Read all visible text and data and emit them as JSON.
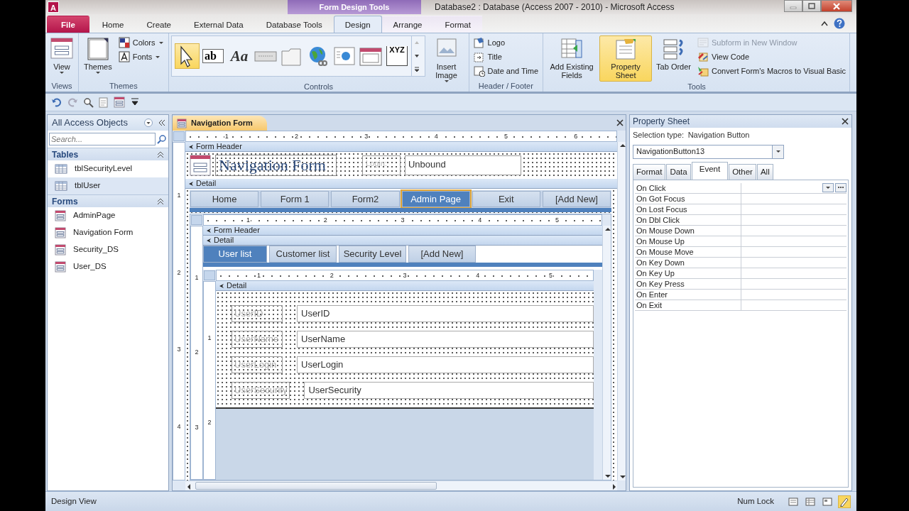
{
  "window": {
    "logo": "A",
    "context_group": "Form Design Tools",
    "title": "Database2 : Database (Access 2007 - 2010)  -  Microsoft Access"
  },
  "ribbon_tabs": [
    {
      "label": "File",
      "kind": "file",
      "selected": false
    },
    {
      "label": "Home",
      "kind": "tab",
      "selected": false
    },
    {
      "label": "Create",
      "kind": "tab",
      "selected": false
    },
    {
      "label": "External Data",
      "kind": "tab",
      "selected": false
    },
    {
      "label": "Database Tools",
      "kind": "tab",
      "selected": false
    },
    {
      "label": "Design",
      "kind": "tab",
      "selected": true
    },
    {
      "label": "Arrange",
      "kind": "tab",
      "selected": false
    },
    {
      "label": "Format",
      "kind": "tab",
      "selected": false
    }
  ],
  "ribbon_groups": [
    {
      "label": "Views",
      "items": [
        {
          "kind": "large",
          "label": "View",
          "dropdown": true
        }
      ]
    },
    {
      "label": "Themes",
      "items": [
        {
          "kind": "large",
          "label": "Themes",
          "dropdown": true
        },
        {
          "kind": "small",
          "label": "Colors",
          "dropdown": true
        },
        {
          "kind": "small",
          "label": "Fonts",
          "dropdown": true
        }
      ]
    },
    {
      "label": "Controls",
      "items": [
        {
          "kind": "tool",
          "selected": true
        },
        {
          "kind": "tool",
          "selected": false,
          "text": "ab"
        },
        {
          "kind": "tool",
          "selected": false,
          "text": "Aa"
        },
        {
          "kind": "tool",
          "selected": false
        },
        {
          "kind": "tool",
          "selected": false
        },
        {
          "kind": "tool",
          "selected": false
        },
        {
          "kind": "tool",
          "selected": false
        },
        {
          "kind": "tool",
          "selected": false
        },
        {
          "kind": "tool",
          "selected": false,
          "text": "XYZ"
        },
        {
          "kind": "large",
          "label": "Insert Image",
          "dropdown": true
        }
      ]
    },
    {
      "label": "Header / Footer",
      "items": [
        {
          "kind": "small",
          "label": "Logo"
        },
        {
          "kind": "small",
          "label": "Title"
        },
        {
          "kind": "small",
          "label": "Date and Time"
        }
      ]
    },
    {
      "label": "Tools",
      "items": [
        {
          "kind": "large",
          "label": "Add Existing Fields",
          "selected": false
        },
        {
          "kind": "large",
          "label": "Property Sheet",
          "selected": true
        },
        {
          "kind": "large",
          "label": "Tab Order",
          "selected": false
        },
        {
          "kind": "small",
          "label": "Subform in New Window",
          "disabled": true
        },
        {
          "kind": "small",
          "label": "View Code",
          "disabled": false
        },
        {
          "kind": "small",
          "label": "Convert Form's Macros to Visual Basic",
          "disabled": false
        }
      ]
    }
  ],
  "nav_pane": {
    "title": "All Access Objects",
    "search": {
      "placeholder": "Search..."
    },
    "groups": [
      {
        "label": "Tables",
        "kind": "table",
        "items": [
          {
            "label": "tblSecurityLevel",
            "selected": false
          },
          {
            "label": "tblUser",
            "selected": true
          }
        ]
      },
      {
        "label": "Forms",
        "kind": "form",
        "items": [
          {
            "label": "AdminPage",
            "selected": false
          },
          {
            "label": "Navigation Form",
            "selected": false
          },
          {
            "label": "Security_DS",
            "selected": false
          },
          {
            "label": "User_DS",
            "selected": false
          }
        ]
      }
    ]
  },
  "document": {
    "tab": "Navigation Form",
    "ruler": [
      "1",
      "2",
      "3",
      "4",
      "5",
      "6"
    ],
    "vruler": [
      "1",
      "2",
      "3",
      "4"
    ],
    "form_header": {
      "section": "Form Header",
      "title": "Navigation Form",
      "login_label": "Login:",
      "login_value": "Unbound"
    },
    "detail": {
      "section": "Detail",
      "nav_buttons": [
        {
          "label": "Home",
          "selected": false
        },
        {
          "label": "Form 1",
          "selected": false
        },
        {
          "label": "Form2",
          "selected": false
        },
        {
          "label": "Admin Page",
          "selected": true
        },
        {
          "label": "Exit",
          "selected": false
        },
        {
          "label": "[Add New]",
          "selected": false
        }
      ],
      "subform": {
        "ruler": [
          "1",
          "2",
          "3",
          "4",
          "5"
        ],
        "vruler": [
          "1",
          "2",
          "3"
        ],
        "header_section": "Form Header",
        "detail_section": "Detail",
        "tabs": [
          {
            "label": "User list",
            "selected": true
          },
          {
            "label": "Customer list",
            "selected": false
          },
          {
            "label": "Security Level",
            "selected": false
          },
          {
            "label": "[Add New]",
            "selected": false
          }
        ],
        "inner": {
          "ruler": [
            "1",
            "2",
            "3",
            "4",
            "5"
          ],
          "vruler": [
            "1",
            "2"
          ],
          "section": "Detail",
          "fields": [
            {
              "label": "UserID",
              "value": "UserID"
            },
            {
              "label": "UserName",
              "value": "UserName"
            },
            {
              "label": "UserLogin",
              "value": "UserLogin"
            },
            {
              "label": "UserSecurity",
              "value": "UserSecurity"
            }
          ]
        }
      }
    }
  },
  "property_sheet": {
    "title": "Property Sheet",
    "selection_label": "Selection type:",
    "selection_type": "Navigation Button",
    "object": "NavigationButton13",
    "tabs": [
      {
        "label": "Format",
        "selected": false
      },
      {
        "label": "Data",
        "selected": false
      },
      {
        "label": "Event",
        "selected": true
      },
      {
        "label": "Other",
        "selected": false
      },
      {
        "label": "All",
        "selected": false
      }
    ],
    "properties": [
      {
        "name": "On Click",
        "selected": true
      },
      {
        "name": "On Got Focus",
        "selected": false
      },
      {
        "name": "On Lost Focus",
        "selected": false
      },
      {
        "name": "On Dbl Click",
        "selected": false
      },
      {
        "name": "On Mouse Down",
        "selected": false
      },
      {
        "name": "On Mouse Up",
        "selected": false
      },
      {
        "name": "On Mouse Move",
        "selected": false
      },
      {
        "name": "On Key Down",
        "selected": false
      },
      {
        "name": "On Key Up",
        "selected": false
      },
      {
        "name": "On Key Press",
        "selected": false
      },
      {
        "name": "On Enter",
        "selected": false
      },
      {
        "name": "On Exit",
        "selected": false
      }
    ]
  },
  "status_bar": {
    "left": "Design View",
    "right": "Num Lock",
    "views": [
      {
        "selected": false
      },
      {
        "selected": false
      },
      {
        "selected": false
      },
      {
        "selected": true
      }
    ]
  }
}
